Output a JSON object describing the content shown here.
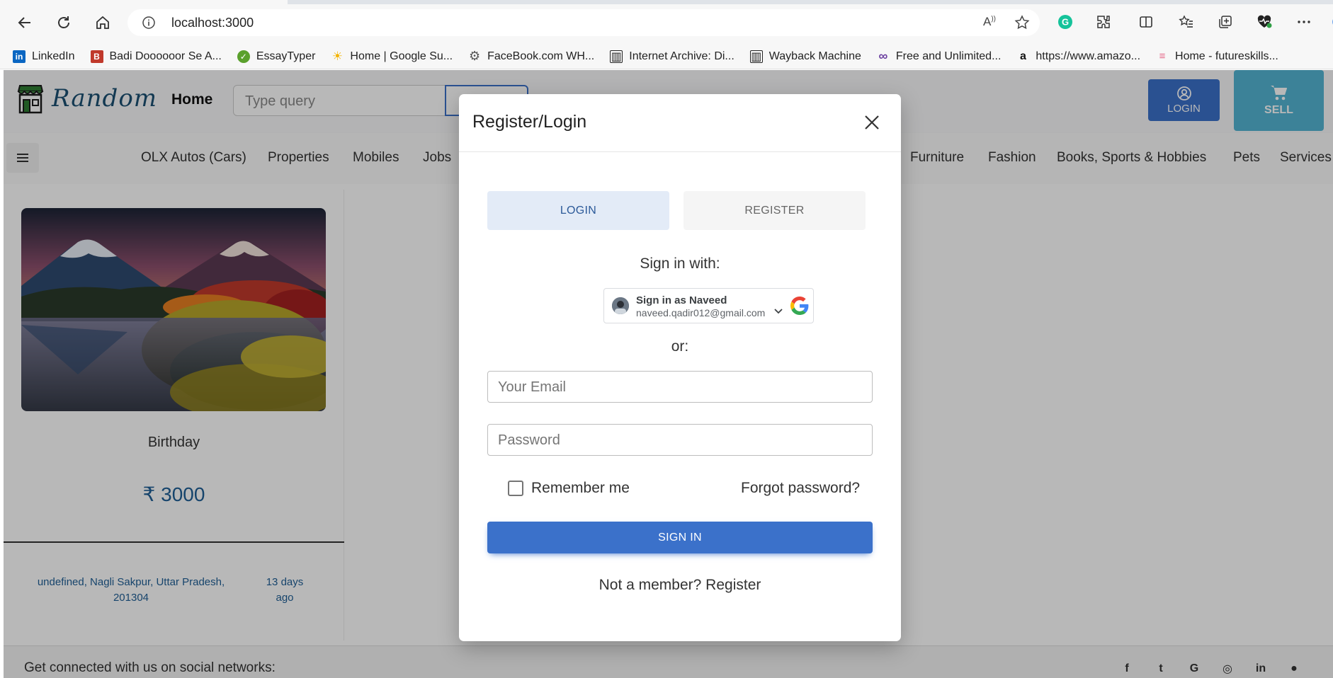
{
  "browser": {
    "url": "localhost:3000",
    "bookmarks": [
      {
        "label": "LinkedIn",
        "icon": "linkedin-icon",
        "color": "#0a66c2",
        "glyph": "in"
      },
      {
        "label": "Badi Doooooor Se A...",
        "icon": "bookmark-favicon",
        "color": "#c0392b",
        "glyph": "B"
      },
      {
        "label": "EssayTyper",
        "icon": "essaytyper-icon",
        "color": "#5aa02c",
        "glyph": "✓"
      },
      {
        "label": "Home | Google Su...",
        "icon": "sun-icon",
        "color": "#f4b400",
        "glyph": "☀"
      },
      {
        "label": "FaceBook.com WH...",
        "icon": "gear-icon",
        "color": "#555555",
        "glyph": "⚙"
      },
      {
        "label": "Internet Archive: Di...",
        "icon": "archive-icon",
        "color": "#222222",
        "glyph": "▥"
      },
      {
        "label": "Wayback Machine",
        "icon": "archive-icon",
        "color": "#222222",
        "glyph": "▥"
      },
      {
        "label": "Free and Unlimited...",
        "icon": "infinity-icon",
        "color": "#6b3fa0",
        "glyph": "∞"
      },
      {
        "label": "https://www.amazo...",
        "icon": "amazon-icon",
        "color": "#ffffff",
        "glyph": "a"
      },
      {
        "label": "Home - futureskills...",
        "icon": "futureskills-icon",
        "color": "#e56a8a",
        "glyph": "≡"
      }
    ]
  },
  "header": {
    "brand": "Random",
    "home": "Home",
    "search_placeholder": "Type query",
    "login": "LOGIN",
    "sell": "SELL"
  },
  "categories": [
    "OLX Autos (Cars)",
    "Properties",
    "Mobiles",
    "Jobs",
    "Furniture",
    "Fashion",
    "Books, Sports & Hobbies",
    "Pets",
    "Services"
  ],
  "listing": {
    "title": "Birthday",
    "price": "₹ 3000",
    "location": "undefined, Nagli Sakpur, Uttar Pradesh, 201304",
    "time": "13 days ago"
  },
  "footer": {
    "text": "Get connected with us on social networks:"
  },
  "modal": {
    "title": "Register/Login",
    "tab_login": "LOGIN",
    "tab_register": "REGISTER",
    "sign_in_with": "Sign in with:",
    "google_line1": "Sign in as Naveed",
    "google_line2": "naveed.qadir012@gmail.com",
    "or": "or:",
    "email_placeholder": "Your Email",
    "password_placeholder": "Password",
    "remember": "Remember me",
    "forgot": "Forgot password?",
    "sign_in": "SIGN IN",
    "not_member": "Not a member? Register"
  },
  "colors": {
    "primary": "#3b71ca",
    "info": "#54b4d3",
    "price": "#1f5f96"
  }
}
